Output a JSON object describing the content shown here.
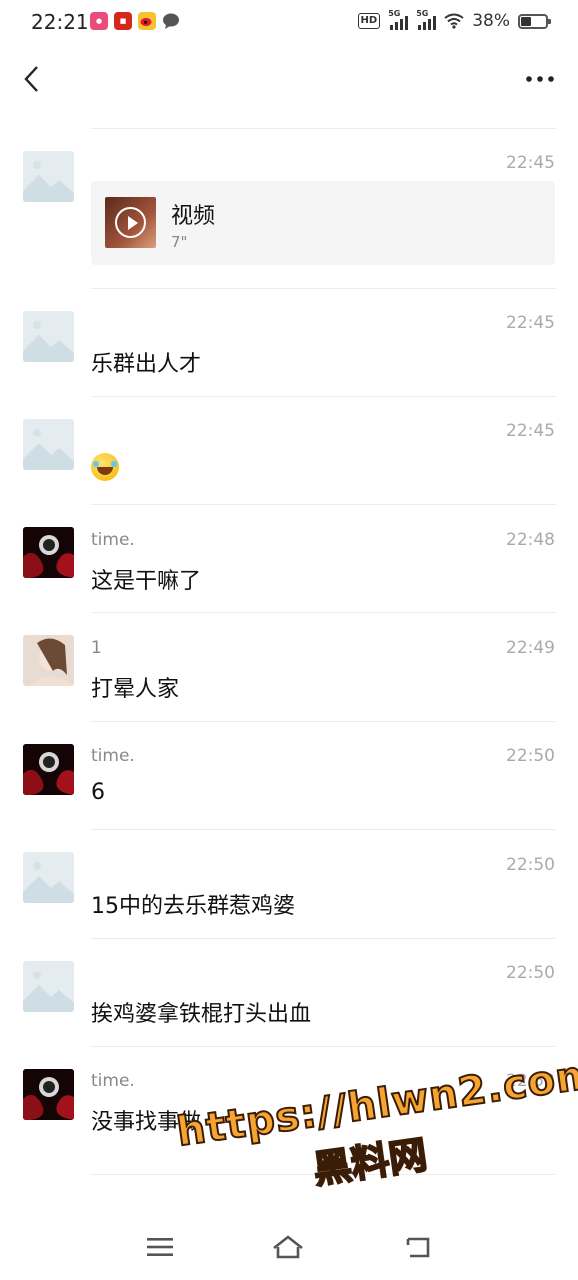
{
  "status_bar": {
    "time": "22:21",
    "network_1": "5G",
    "network_2": "5G",
    "battery": "38%"
  },
  "messages": [
    {
      "sender": "",
      "time": "22:45",
      "type": "video",
      "video_title": "视频",
      "video_duration": "7\""
    },
    {
      "sender": "",
      "time": "22:45",
      "type": "text",
      "text": "乐群出人才"
    },
    {
      "sender": "",
      "time": "22:45",
      "type": "emoji",
      "emoji": "rofl-emoji"
    },
    {
      "sender": "time.",
      "time": "22:48",
      "type": "text",
      "text": "这是干嘛了"
    },
    {
      "sender": "1",
      "time": "22:49",
      "type": "text",
      "text": "打晕人家"
    },
    {
      "sender": "time.",
      "time": "22:50",
      "type": "text",
      "text": "6"
    },
    {
      "sender": "",
      "time": "22:50",
      "type": "text",
      "text": "15中的去乐群惹鸡婆"
    },
    {
      "sender": "",
      "time": "22:50",
      "type": "text",
      "text": "挨鸡婆拿铁棍打头出血"
    },
    {
      "sender": "time.",
      "time": "22:53",
      "type": "text",
      "text": "没事找事做"
    }
  ],
  "watermark": {
    "url": "https://hlwn2.com",
    "name": "黑料网"
  },
  "colors": {
    "accent_watermark": "#f6a630",
    "divider": "#ebebeb",
    "time_text": "#aaaaaa"
  }
}
